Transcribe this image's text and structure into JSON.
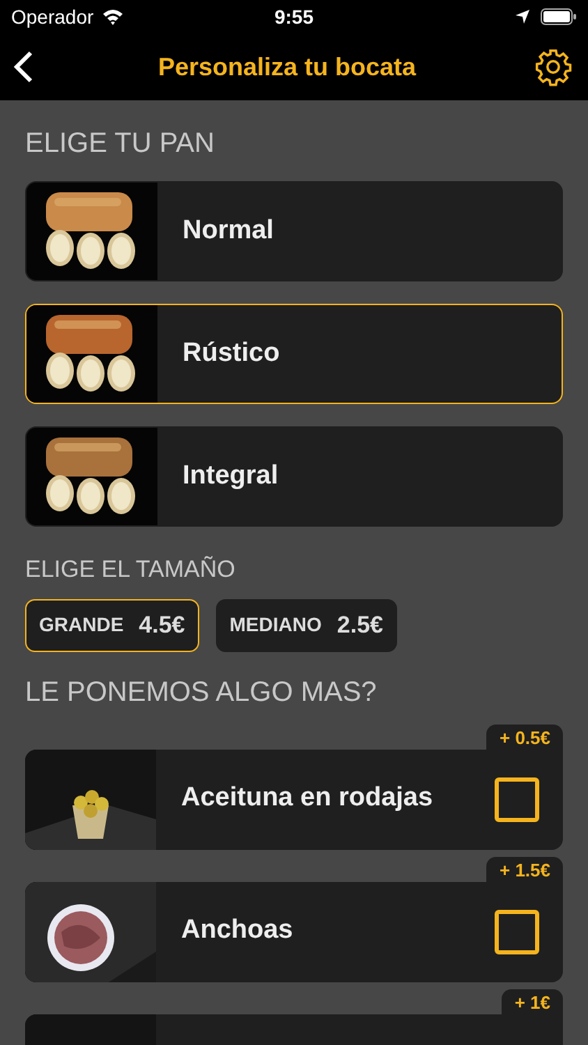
{
  "status_bar": {
    "carrier": "Operador",
    "time": "9:55"
  },
  "nav": {
    "title": "Personaliza tu bocata"
  },
  "bread_section": {
    "title": "ELIGE TU PAN",
    "items": [
      {
        "label": "Normal",
        "selected": false
      },
      {
        "label": "Rústico",
        "selected": true
      },
      {
        "label": "Integral",
        "selected": false
      }
    ]
  },
  "size_section": {
    "title": "ELIGE EL TAMAÑO",
    "options": [
      {
        "label": "GRANDE",
        "price": "4.5€",
        "selected": true
      },
      {
        "label": "MEDIANO",
        "price": "2.5€",
        "selected": false
      }
    ]
  },
  "extras_section": {
    "title": "LE PONEMOS ALGO MAS?",
    "items": [
      {
        "price": "+ 0.5€",
        "name": "Aceituna en rodajas",
        "checked": false,
        "kind": "olives"
      },
      {
        "price": "+ 1.5€",
        "name": "Anchoas",
        "checked": false,
        "kind": "anchovies"
      },
      {
        "price": "+ 1€",
        "kind": "plain"
      }
    ]
  }
}
